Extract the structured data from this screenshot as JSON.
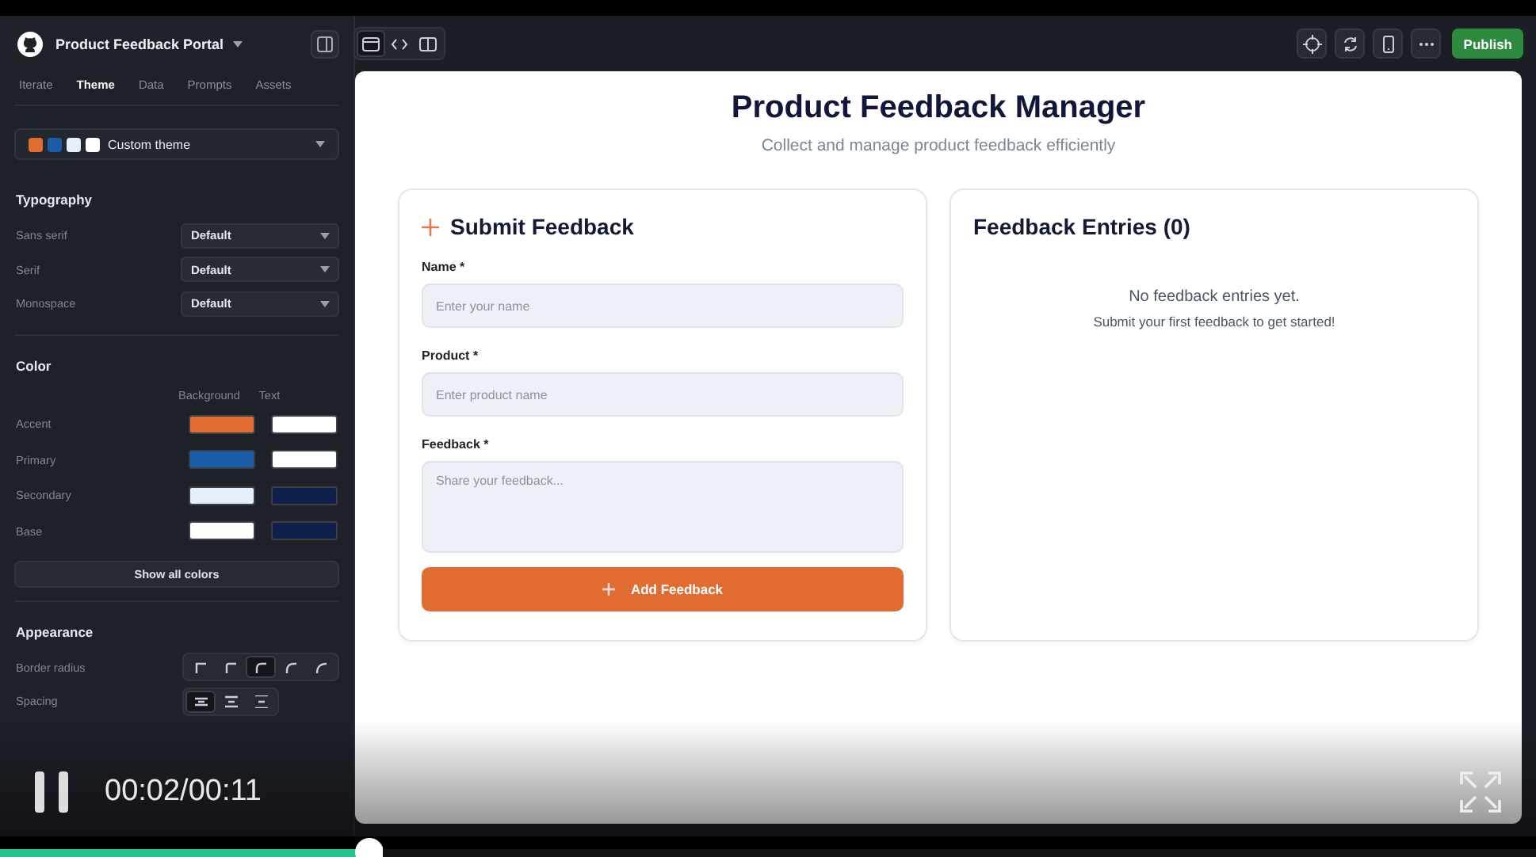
{
  "app": {
    "project": "Product Feedback Portal",
    "tabs": [
      {
        "label": "Iterate",
        "selected": false
      },
      {
        "label": "Theme",
        "selected": true
      },
      {
        "label": "Data",
        "selected": false
      },
      {
        "label": "Prompts",
        "selected": false
      },
      {
        "label": "Assets",
        "selected": false
      }
    ],
    "theme_select": {
      "value": "Custom theme",
      "swatches": [
        {
          "color": "#e06c32"
        },
        {
          "color": "#1a5ca8"
        },
        {
          "color": "#e6eefa"
        },
        {
          "color": "#ffffff"
        }
      ]
    },
    "typography": {
      "title": "Typography",
      "rows": [
        {
          "label": "Sans serif",
          "value": "Default"
        },
        {
          "label": "Serif",
          "value": "Default"
        },
        {
          "label": "Monospace",
          "value": "Default"
        }
      ]
    },
    "color": {
      "title": "Color",
      "columns": [
        "Background",
        "Text"
      ],
      "rows": [
        {
          "label": "Accent",
          "background": {
            "color": "#e06c32"
          },
          "text": {
            "color": "#ffffff"
          }
        },
        {
          "label": "Primary",
          "background": {
            "color": "#1a5ca8"
          },
          "text": {
            "color": "#ffffff"
          }
        },
        {
          "label": "Secondary",
          "background": {
            "color": "#e6eefa"
          },
          "text": {
            "color": "#0d1f4a"
          }
        },
        {
          "label": "Base",
          "background": {
            "color": "#ffffff"
          },
          "text": {
            "color": "#0d1f4a"
          }
        }
      ],
      "button": "Show all colors"
    },
    "appearance": {
      "title": "Appearance",
      "rows": [
        {
          "label": "Border radius",
          "kind": "radius",
          "options": [
            {
              "selected": false
            },
            {
              "selected": false
            },
            {
              "selected": true
            },
            {
              "selected": false
            },
            {
              "selected": false
            }
          ]
        },
        {
          "label": "Spacing",
          "kind": "spacing",
          "options": [
            {
              "selected": true
            },
            {
              "selected": false
            },
            {
              "selected": false
            }
          ]
        }
      ]
    },
    "views": [
      {
        "kind": "preview",
        "selected": true
      },
      {
        "kind": "code",
        "selected": false
      },
      {
        "kind": "split",
        "selected": false
      }
    ],
    "publish": "Publish",
    "preview": {
      "title": "Product Feedback Manager",
      "subtitle": "Collect and manage product feedback efficiently",
      "form": {
        "title": "Submit Feedback",
        "fields": [
          {
            "label": "Name *",
            "placeholder": "Enter your name",
            "kind": "input"
          },
          {
            "label": "Product *",
            "placeholder": "Enter product name",
            "kind": "input"
          },
          {
            "label": "Feedback *",
            "placeholder": "Share your feedback...",
            "kind": "textarea"
          }
        ],
        "button": "Add Feedback"
      },
      "entries": {
        "title": "Feedback Entries (0)",
        "empty_title": "No feedback entries yet.",
        "empty_text": "Submit your first feedback to get started!"
      }
    }
  },
  "video": {
    "playing": true,
    "time": "00:02/00:11",
    "level": 0.24
  }
}
